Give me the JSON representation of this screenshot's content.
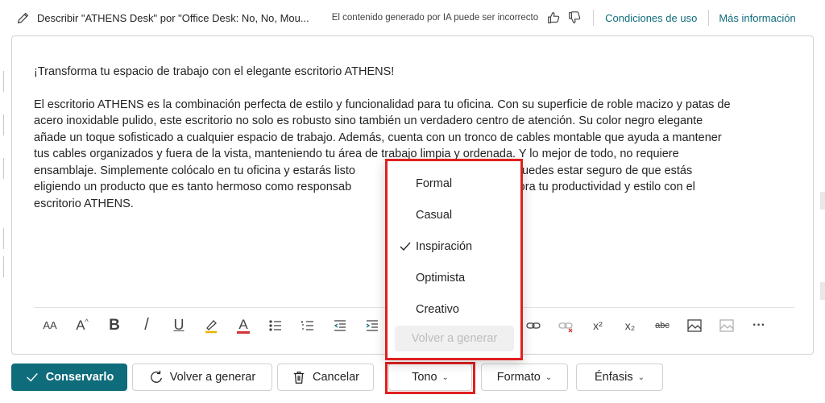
{
  "header": {
    "title": "Describir \"ATHENS Desk\" por \"Office Desk: No, No, Mou...",
    "disclaimer": "El contenido generado por IA puede ser incorrecto",
    "terms_link": "Condiciones de uso",
    "more_info_link": "Más información",
    "icons": [
      "pen-icon",
      "thumbs-up-icon",
      "thumbs-down-icon"
    ]
  },
  "editor": {
    "heading": "¡Transforma tu espacio de trabajo con el elegante escritorio ATHENS!",
    "line1": "El escritorio ATHENS es la combinación perfecta de estilo y funcionalidad para tu oficina. Con su superficie de roble macizo y patas de",
    "line2": "acero inoxidable pulido, este escritorio no solo es robusto sino también un verdadero centro de atención. Su color negro elegante",
    "line3": "añade un toque sofisticado a cualquier espacio de trabajo. Además, cuenta con un tronco de cables montable que ayuda a mantener",
    "line4": "tus cables organizados y fuera de la vista, manteniendo tu área de trabajo limpia y ordenada. Y lo mejor de todo, no requiere",
    "line5a": "ensamblaje. Simplemente colócalo en tu oficina y estarás listo",
    "line5b": "cación FSC, puedes estar seguro de que estás",
    "line6a": "eligiendo un producto que es tanto hermoso como responsab",
    "line6b": "e. Mejora tu productividad y estilo con el",
    "line7": "escritorio ATHENS."
  },
  "toolbar": {
    "font_size_label": "AA",
    "grow_font_label": "A",
    "bold_label": "B",
    "italic_label": "/",
    "underline_label": "U",
    "font_color_label": "A",
    "superscript_label": "x²",
    "subscript_label": "x₂",
    "strikethrough_label": "abc",
    "more_label": "···"
  },
  "tone_menu": {
    "items": [
      {
        "label": "Formal",
        "checked": false
      },
      {
        "label": "Casual",
        "checked": false
      },
      {
        "label": "Inspiración",
        "checked": true
      },
      {
        "label": "Optimista",
        "checked": false
      },
      {
        "label": "Creativo",
        "checked": false
      }
    ],
    "regenerate_label": "Volver a generar"
  },
  "actions": {
    "keep_label": "Conservarlo",
    "regenerate_label": "Volver a generar",
    "cancel_label": "Cancelar",
    "tone_label": "Tono",
    "format_label": "Formato",
    "emphasis_label": "Énfasis",
    "chevron": "⌄"
  },
  "colors": {
    "accent": "#0f6c7b",
    "highlight": "#e02020",
    "text": "#242424"
  }
}
